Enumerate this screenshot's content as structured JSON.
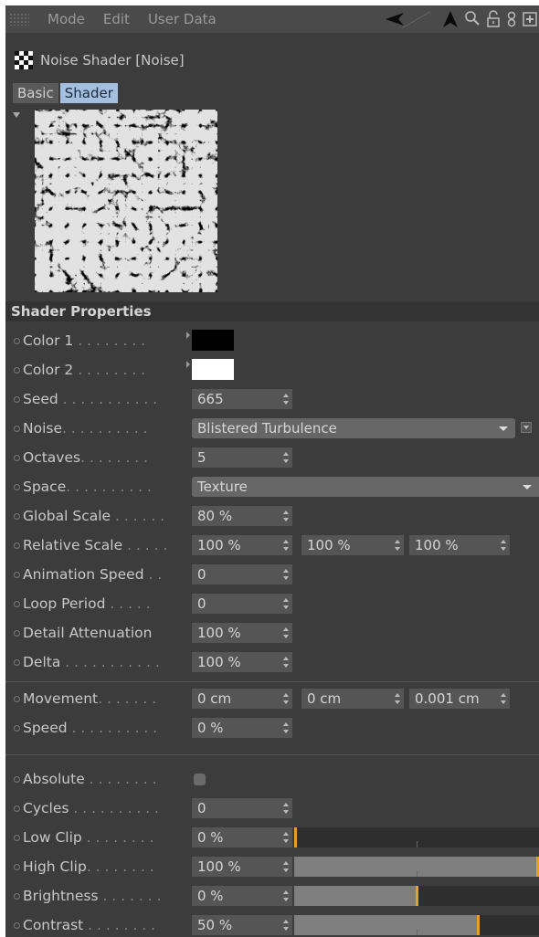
{
  "menu": {
    "items": [
      "Mode",
      "Edit",
      "User Data"
    ]
  },
  "toolbar": {
    "icons": [
      "back-arrow-icon",
      "up-arrow-icon",
      "search-icon",
      "lock-icon",
      "link-icon",
      "new-panel-icon"
    ]
  },
  "header": {
    "title": "Noise Shader [Noise]",
    "icon": "checker-icon"
  },
  "tabs": [
    {
      "label": "Basic",
      "active": false
    },
    {
      "label": "Shader",
      "active": true
    }
  ],
  "section": {
    "title": "Shader Properties"
  },
  "properties": {
    "color1": {
      "label": "Color 1",
      "dots": " . . . . . . . .",
      "color": "#000000"
    },
    "color2": {
      "label": "Color 2",
      "dots": " . . . . . . . .",
      "color": "#ffffff"
    },
    "seed": {
      "label": "Seed",
      "dots": " . . . . . . . . . . .",
      "value": "665"
    },
    "noise": {
      "label": "Noise",
      "dots": ". . . . . . . . . .",
      "value": "Blistered Turbulence"
    },
    "octaves": {
      "label": "Octaves",
      "dots": ". . . . . . . .",
      "value": "5"
    },
    "space": {
      "label": "Space",
      "dots": ". . . . . . . . . .",
      "value": "Texture"
    },
    "global_scale": {
      "label": "Global Scale",
      "dots": " . . . . . .",
      "value": "80 %"
    },
    "relative_scale": {
      "label": "Relative Scale",
      "dots": " . . . . .",
      "values": [
        "100 %",
        "100 %",
        "100 %"
      ]
    },
    "animation_speed": {
      "label": "Animation Speed",
      "dots": " . .",
      "value": "0"
    },
    "loop_period": {
      "label": "Loop Period",
      "dots": " . . . . .",
      "value": "0"
    },
    "detail_attenuation": {
      "label": "Detail Attenuation",
      "dots": "",
      "value": "100 %"
    },
    "delta": {
      "label": "Delta",
      "dots": " . . . . . . . . . . .",
      "value": "100 %"
    },
    "movement": {
      "label": "Movement",
      "dots": ". . . . . . .",
      "values": [
        "0 cm",
        "0 cm",
        "0.001 cm"
      ]
    },
    "speed": {
      "label": "Speed",
      "dots": " . . . . . . . . . .",
      "value": "0 %"
    },
    "absolute": {
      "label": "Absolute",
      "dots": " . . . . . . . .",
      "checked": false
    },
    "cycles": {
      "label": "Cycles",
      "dots": " . . . . . . . . . .",
      "value": "0"
    },
    "low_clip": {
      "label": "Low Clip",
      "dots": " . . . . . . . .",
      "value": "0 %",
      "level": 0.0
    },
    "high_clip": {
      "label": "High Clip",
      "dots": ". . . . . . . .",
      "value": "100 %",
      "level": 1.0
    },
    "brightness": {
      "label": "Brightness",
      "dots": " . . . . . . .",
      "value": "0 %",
      "level": 0.5
    },
    "contrast": {
      "label": "Contrast",
      "dots": " . . . . . . . .",
      "value": "50 %",
      "level": 0.75
    }
  },
  "colors": {
    "accent": "#a4bfe0",
    "slider_mark": "#e8a020",
    "panel_bg": "#3c3c3c"
  }
}
